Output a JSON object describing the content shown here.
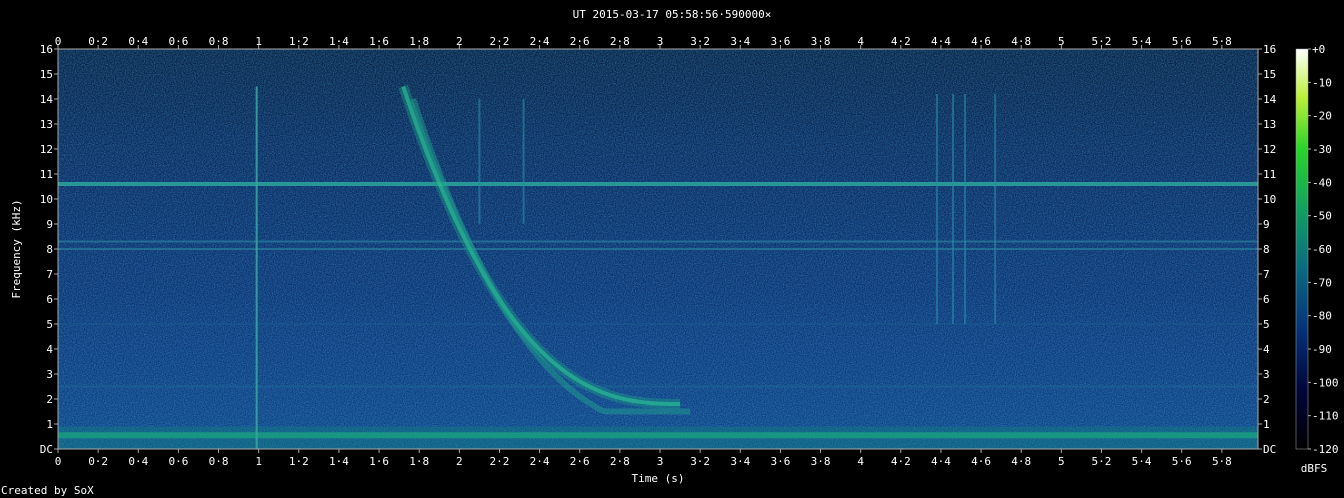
{
  "chart_data": {
    "type": "heatmap",
    "title": "UT 2015-03-17 05:58:56·590000×",
    "xlabel": "Time (s)",
    "ylabel": "Frequency (kHz)",
    "xlim": [
      0,
      5.98
    ],
    "ylim": [
      0,
      16
    ],
    "x_ticks": [
      "0",
      "0·2",
      "0·4",
      "0·6",
      "0·8",
      "1",
      "1·2",
      "1·4",
      "1·6",
      "1·8",
      "2",
      "2·2",
      "2·4",
      "2·6",
      "2·8",
      "3",
      "3·2",
      "3·4",
      "3·6",
      "3·8",
      "4",
      "4·2",
      "4·4",
      "4·6",
      "4·8",
      "5",
      "5·2",
      "5·4",
      "5·6",
      "5·8"
    ],
    "y_ticks": [
      "DC",
      "1",
      "2",
      "3",
      "4",
      "5",
      "6",
      "7",
      "8",
      "9",
      "10",
      "11",
      "12",
      "13",
      "14",
      "15",
      "16"
    ],
    "colorbar": {
      "label": "dBFS",
      "range": [
        -120,
        0
      ],
      "ticks": [
        "+0",
        "-10",
        "-20",
        "-30",
        "-40",
        "-50",
        "-60",
        "-70",
        "-80",
        "-90",
        "-100",
        "-110",
        "-120"
      ]
    },
    "features": {
      "noise_floor_db": -100,
      "horizontal_lines_khz": [
        10.6,
        8.3,
        8.0,
        0.55,
        2.5,
        5.0
      ],
      "whistler": {
        "start_s": 1.72,
        "start_khz": 14.5,
        "end_s": 3.1,
        "end_khz": 1.8
      },
      "vertical_spikes_s": [
        0.99,
        2.1,
        2.32,
        4.38,
        4.46,
        4.52,
        4.67
      ]
    },
    "credit": "Created by SoX"
  }
}
